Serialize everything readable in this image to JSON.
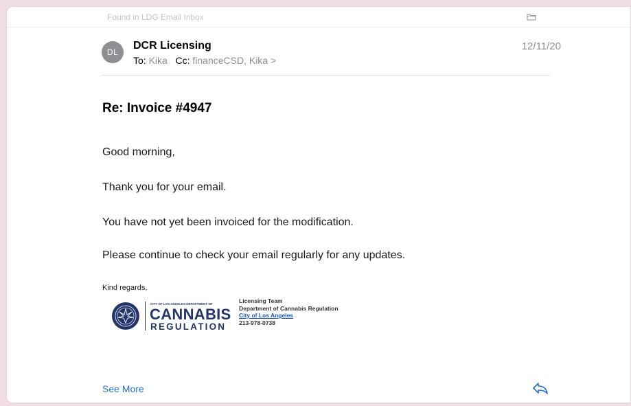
{
  "topbar": {
    "found_text": "Found in LDG Email Inbox",
    "folder_icon": "folder-icon"
  },
  "message": {
    "avatar_initials": "DL",
    "sender": "DCR Licensing",
    "to_label": "To:",
    "to_value": "Kika",
    "cc_label": "Cc:",
    "cc_value": "financeCSD, Kika",
    "chevron": ">",
    "date": "12/11/20",
    "subject": "Re: Invoice #4947",
    "body": [
      "Good morning,",
      "Thank you for your email.",
      "You have not yet been invoiced for the modification.",
      "Please continue to check your email regularly for any updates."
    ],
    "regards": "Kind regards,"
  },
  "signature": {
    "dept_small": "CITY OF LOS ANGELES DEPARTMENT OF",
    "dept_big": "CANNABIS",
    "dept_reg": "REGULATION",
    "line1": "Licensing Team",
    "line2": "Department of Cannabis Regulation",
    "line3": "City of Los Angeles",
    "line4": "213-978-0738"
  },
  "footer": {
    "see_more": "See More",
    "reply_icon": "reply-icon"
  },
  "colors": {
    "accent": "#1f6fd6",
    "avatar": "#8e8e93",
    "brand_navy": "#23356b",
    "frame": "#f0dde3"
  }
}
